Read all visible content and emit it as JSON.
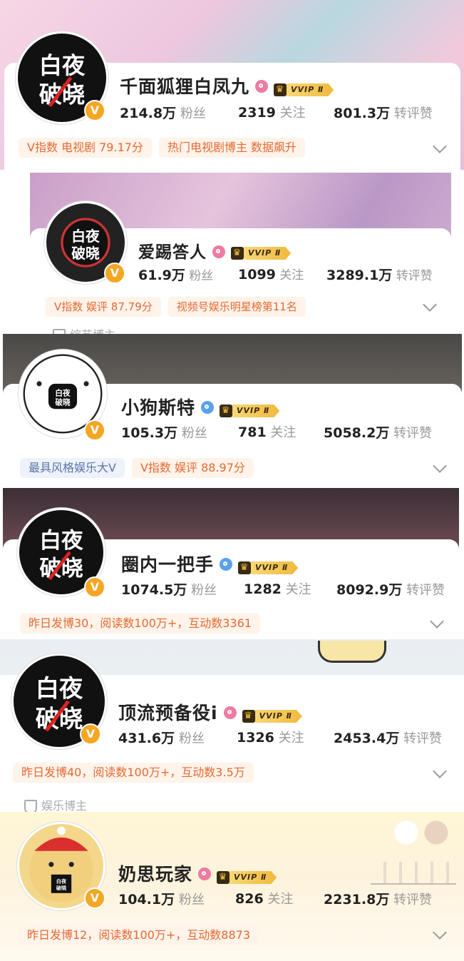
{
  "profiles": [
    {
      "name": "千面狐狸白凤九",
      "gender": "female",
      "vip_label": "VVIP Ⅱ",
      "stats": [
        {
          "num": "214.8万",
          "label": "粉丝"
        },
        {
          "num": "2319",
          "label": "关注"
        },
        {
          "num": "801.3万",
          "label": "转评赞"
        }
      ],
      "tags": [
        "V指数 电视剧 79.17分",
        "热门电视剧博主 数据飙升"
      ]
    },
    {
      "name": "爱踢答人",
      "gender": "female",
      "vip_label": "VVIP Ⅱ",
      "stats": [
        {
          "num": "61.9万",
          "label": "粉丝"
        },
        {
          "num": "1099",
          "label": "关注"
        },
        {
          "num": "3289.1万",
          "label": "转评赞"
        }
      ],
      "tags": [
        "V指数 娱评 87.79分",
        "视频号娱乐明星榜第11名"
      ],
      "sub_partial": "综艺博主"
    },
    {
      "name": "小狗斯特",
      "gender": "male",
      "vip_label": "VVIP Ⅱ",
      "stats": [
        {
          "num": "105.3万",
          "label": "粉丝"
        },
        {
          "num": "781",
          "label": "关注"
        },
        {
          "num": "5058.2万",
          "label": "转评赞"
        }
      ],
      "tags": [
        "最具风格娱乐大V",
        "V指数 娱评 88.97分"
      ]
    },
    {
      "name": "圈内一把手",
      "gender": "male",
      "vip_label": "VVIP Ⅱ",
      "stats": [
        {
          "num": "1074.5万",
          "label": "粉丝"
        },
        {
          "num": "1282",
          "label": "关注"
        },
        {
          "num": "8092.9万",
          "label": "转评赞"
        }
      ],
      "tags": [
        "昨日发博30，阅读数100万+，互动数3361"
      ]
    },
    {
      "name": "顶流预备役i",
      "gender": "female",
      "vip_label": "VVIP Ⅱ",
      "stats": [
        {
          "num": "431.6万",
          "label": "粉丝"
        },
        {
          "num": "1326",
          "label": "关注"
        },
        {
          "num": "2453.4万",
          "label": "转评赞"
        }
      ],
      "tags": [
        "昨日发博40，阅读数100万+，互动数3.5万"
      ],
      "sub": "娱乐博主"
    },
    {
      "name": "奶思玩家",
      "gender": "female",
      "vip_label": "VVIP Ⅱ",
      "stats": [
        {
          "num": "104.1万",
          "label": "粉丝"
        },
        {
          "num": "826",
          "label": "关注"
        },
        {
          "num": "2231.8万",
          "label": "转评赞"
        }
      ],
      "tags": [
        "昨日发博12，阅读数100万+，互动数8873"
      ]
    }
  ],
  "avatar_text": "白夜破晓",
  "verified_badge": "V",
  "colors": {
    "accent_orange": "#e46a32",
    "pill_orange_bg": "#fff3ea",
    "pill_blue_bg": "#eef3fb",
    "vip_gold": "#f1b93d",
    "verified": "#f5a623"
  }
}
